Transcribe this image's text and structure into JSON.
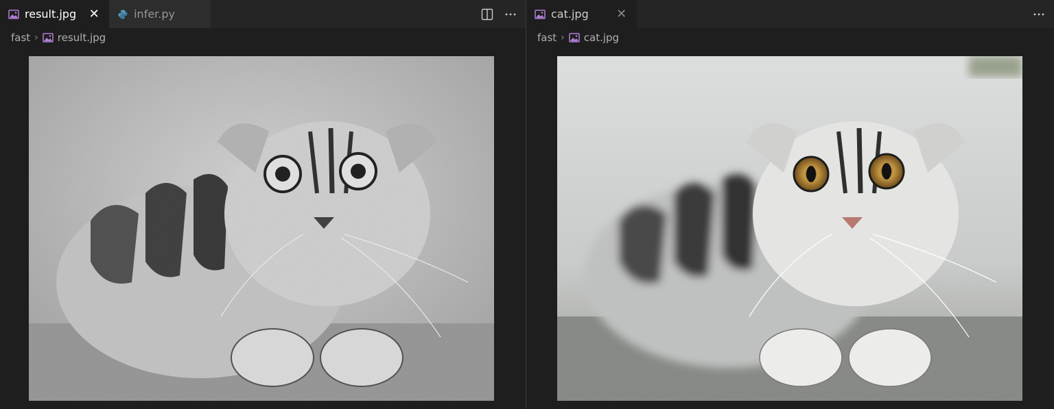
{
  "left_group": {
    "tabs": [
      {
        "label": "result.jpg",
        "icon": "image-icon",
        "active": true
      },
      {
        "label": "infer.py",
        "icon": "python-icon",
        "active": false
      }
    ],
    "actions": [
      "split-editor-icon",
      "more-icon"
    ],
    "breadcrumb": {
      "folder": "fast",
      "file": "result.jpg"
    }
  },
  "right_group": {
    "tabs": [
      {
        "label": "cat.jpg",
        "icon": "image-icon",
        "active": false
      }
    ],
    "actions": [
      "more-icon"
    ],
    "breadcrumb": {
      "folder": "fast",
      "file": "cat.jpg"
    }
  },
  "colors": {
    "editor_bg": "#1e1e1e",
    "tabbar_bg": "#252526",
    "image_icon": "#b180d7",
    "python_icon": "#519aba"
  }
}
